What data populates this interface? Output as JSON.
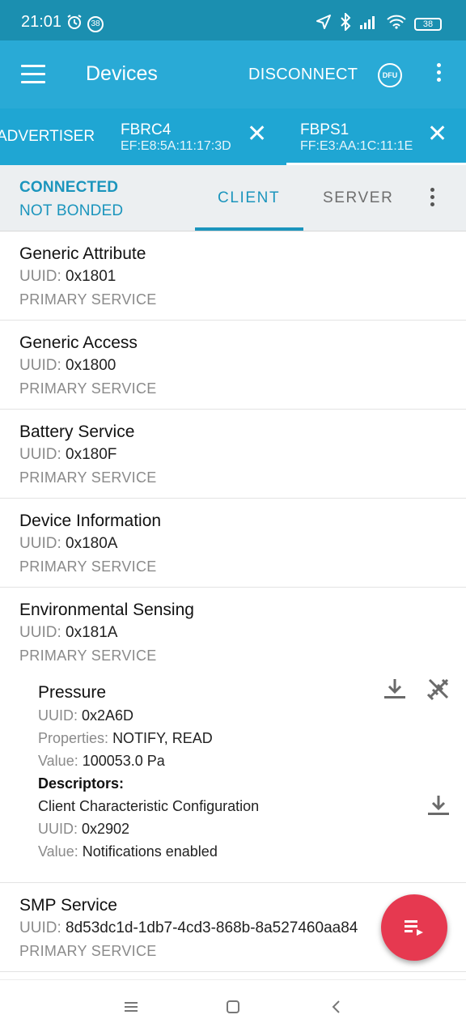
{
  "status_bar": {
    "time": "21:01",
    "notification_badge": "38",
    "battery": "38"
  },
  "app_bar": {
    "title": "Devices",
    "disconnect_label": "DISCONNECT",
    "dfu_label": "DFU"
  },
  "device_tabs": [
    {
      "name": "ADVERTISER",
      "address": ""
    },
    {
      "name": "FBRC4",
      "address": "EF:E8:5A:11:17:3D"
    },
    {
      "name": "FBPS1",
      "address": "FF:E3:AA:1C:11:1E",
      "active": true
    }
  ],
  "connection": {
    "state": "CONNECTED",
    "bond": "NOT BONDED",
    "tabs": [
      "CLIENT",
      "SERVER"
    ],
    "selected_tab": "CLIENT"
  },
  "labels": {
    "uuid": "UUID:",
    "properties": "Properties:",
    "value": "Value:",
    "descriptors": "Descriptors:"
  },
  "services": [
    {
      "name": "Generic Attribute",
      "uuid": "0x1801",
      "type": "PRIMARY SERVICE"
    },
    {
      "name": "Generic Access",
      "uuid": "0x1800",
      "type": "PRIMARY SERVICE"
    },
    {
      "name": "Battery Service",
      "uuid": "0x180F",
      "type": "PRIMARY SERVICE"
    },
    {
      "name": "Device Information",
      "uuid": "0x180A",
      "type": "PRIMARY SERVICE"
    },
    {
      "name": "Environmental Sensing",
      "uuid": "0x181A",
      "type": "PRIMARY SERVICE",
      "characteristic": {
        "name": "Pressure",
        "uuid": "0x2A6D",
        "properties": "NOTIFY, READ",
        "value": "100053.0 Pa",
        "descriptor": {
          "name": "Client Characteristic Configuration",
          "uuid": "0x2902",
          "value": "Notifications enabled"
        }
      }
    },
    {
      "name": "SMP Service",
      "uuid": "8d53dc1d-1db7-4cd3-868b-8a527460aa84",
      "type": "PRIMARY SERVICE"
    }
  ],
  "colors": {
    "status_bar": "#1b8fb0",
    "app_bar": "#29aad6",
    "accent": "#1b95bd",
    "fab": "#e63950"
  }
}
